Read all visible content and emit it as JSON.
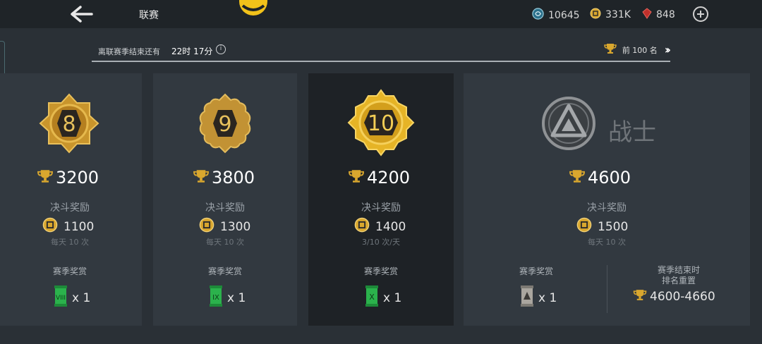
{
  "header": {
    "title": "联赛",
    "currencies": [
      {
        "icon": "gem-swirl-icon",
        "value": "10645"
      },
      {
        "icon": "coin-icon",
        "value": "331K"
      },
      {
        "icon": "ruby-icon",
        "value": "848"
      }
    ]
  },
  "season": {
    "label": "离联赛季结束还有",
    "time_left": "22时 17分",
    "top_rank": "前 100 名"
  },
  "tiers": [
    {
      "rank": "8",
      "trophies": "3200",
      "duel_label": "决斗奖励",
      "coins": "1100",
      "frequency": "每天 10 次",
      "season_reward_label": "赛季奖赏",
      "scroll": "VIII",
      "scroll_count": "x 1"
    },
    {
      "rank": "9",
      "trophies": "3800",
      "duel_label": "决斗奖励",
      "coins": "1300",
      "frequency": "每天 10 次",
      "season_reward_label": "赛季奖赏",
      "scroll": "IX",
      "scroll_count": "x 1"
    },
    {
      "rank": "10",
      "trophies": "4200",
      "duel_label": "决斗奖励",
      "coins": "1400",
      "frequency": "3/10 次/天",
      "season_reward_label": "赛季奖赏",
      "scroll": "X",
      "scroll_count": "x 1",
      "selected": true
    },
    {
      "rank": "战士",
      "trophies": "4600",
      "duel_label": "决斗奖励",
      "coins": "1500",
      "frequency": "每天 10 次",
      "season_reward_label": "赛季奖赏",
      "scroll_count": "x 1",
      "reset_label_line1": "赛季结束时",
      "reset_label_line2": "排名重置",
      "reset_range": "4600-4660"
    }
  ],
  "colors": {
    "gold": "#d9a72e",
    "green_scroll": "#2bb24c",
    "background": "#2a3036"
  }
}
